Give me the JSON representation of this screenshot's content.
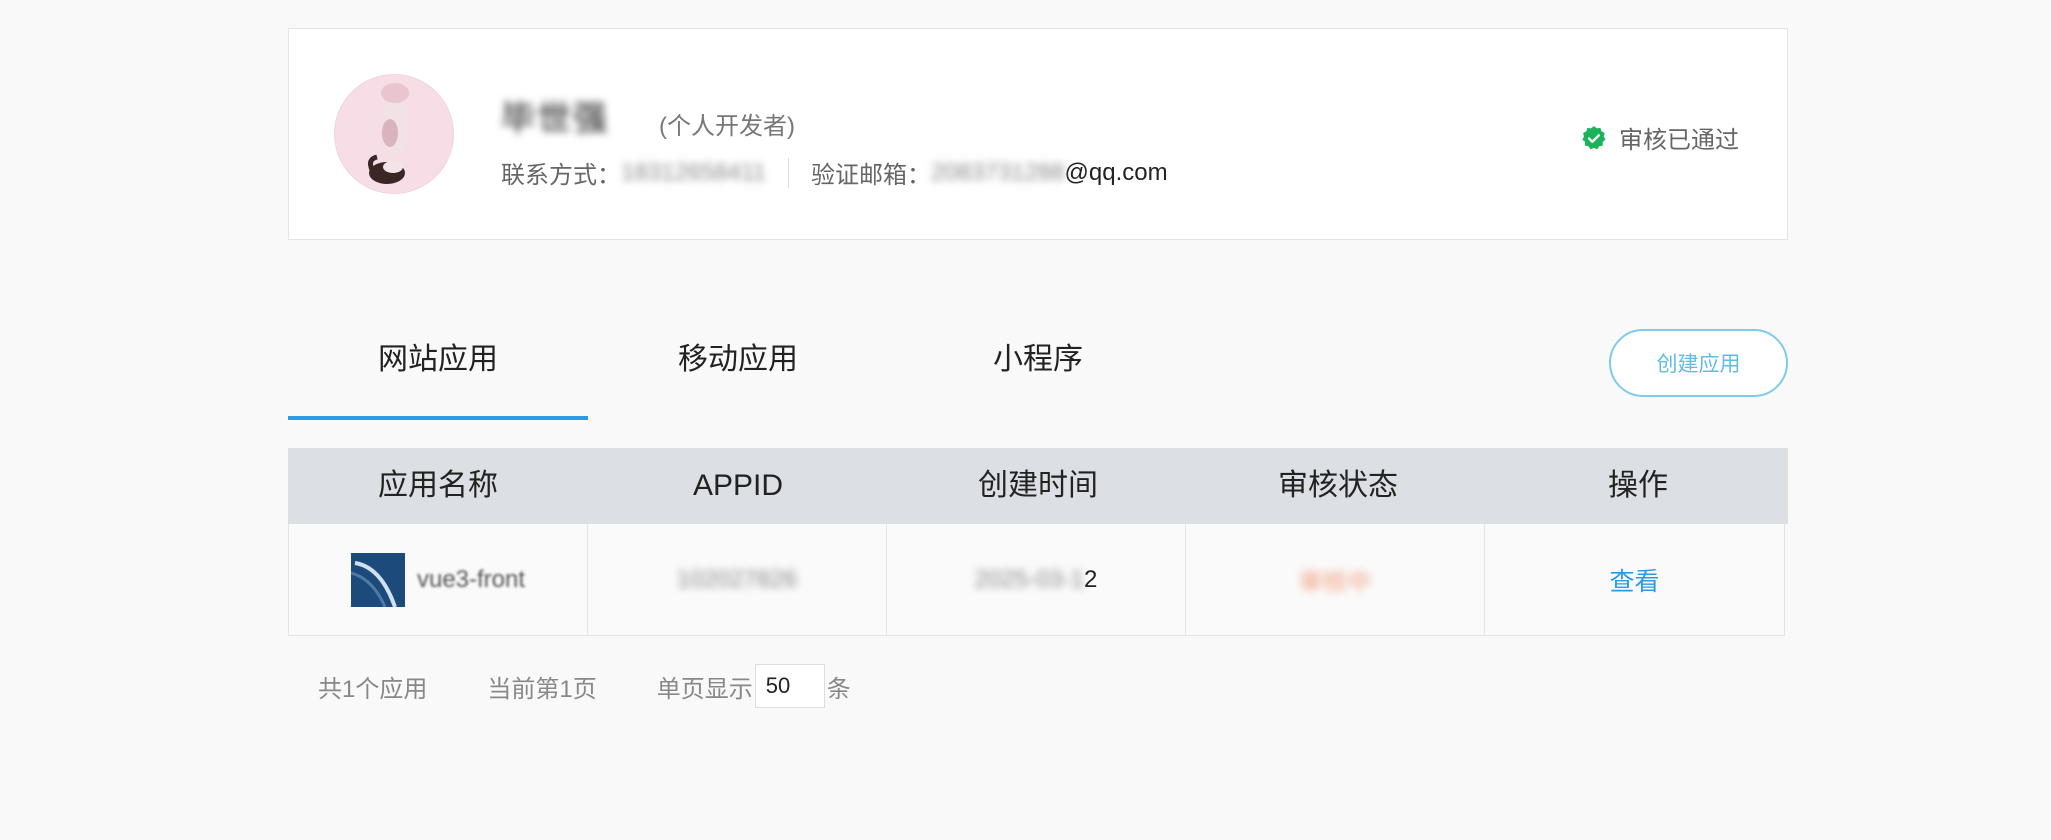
{
  "profile": {
    "name": "毕世强",
    "role": "(个人开发者)",
    "contact_label": "联系方式：",
    "contact_value": "18312658411",
    "email_label": "验证邮箱：",
    "email_masked": "2083731288",
    "email_domain": "@qq.com",
    "status_text": "审核已通过",
    "status_color": "#1ab35c",
    "avatar_icon": "cat-avatar"
  },
  "tabs": [
    {
      "label": "网站应用",
      "active": true
    },
    {
      "label": "移动应用",
      "active": false
    },
    {
      "label": "小程序",
      "active": false
    }
  ],
  "create_button": "创建应用",
  "table": {
    "headers": [
      "应用名称",
      "APPID",
      "创建时间",
      "审核状态",
      "操作"
    ],
    "rows": [
      {
        "app_name": "vue3-front",
        "appid": "102027826",
        "created_masked": "2025-03-1",
        "created_tail": "2",
        "status": "审核中",
        "action": "查看"
      }
    ]
  },
  "pager": {
    "total": "共1个应用",
    "current": "当前第1页",
    "per_page_label": "单页显示",
    "per_page_value": "50",
    "per_page_unit": "条"
  },
  "colors": {
    "accent": "#2a9be6",
    "header_bg": "#dcdfe3",
    "button_border": "#7fcbeb"
  }
}
